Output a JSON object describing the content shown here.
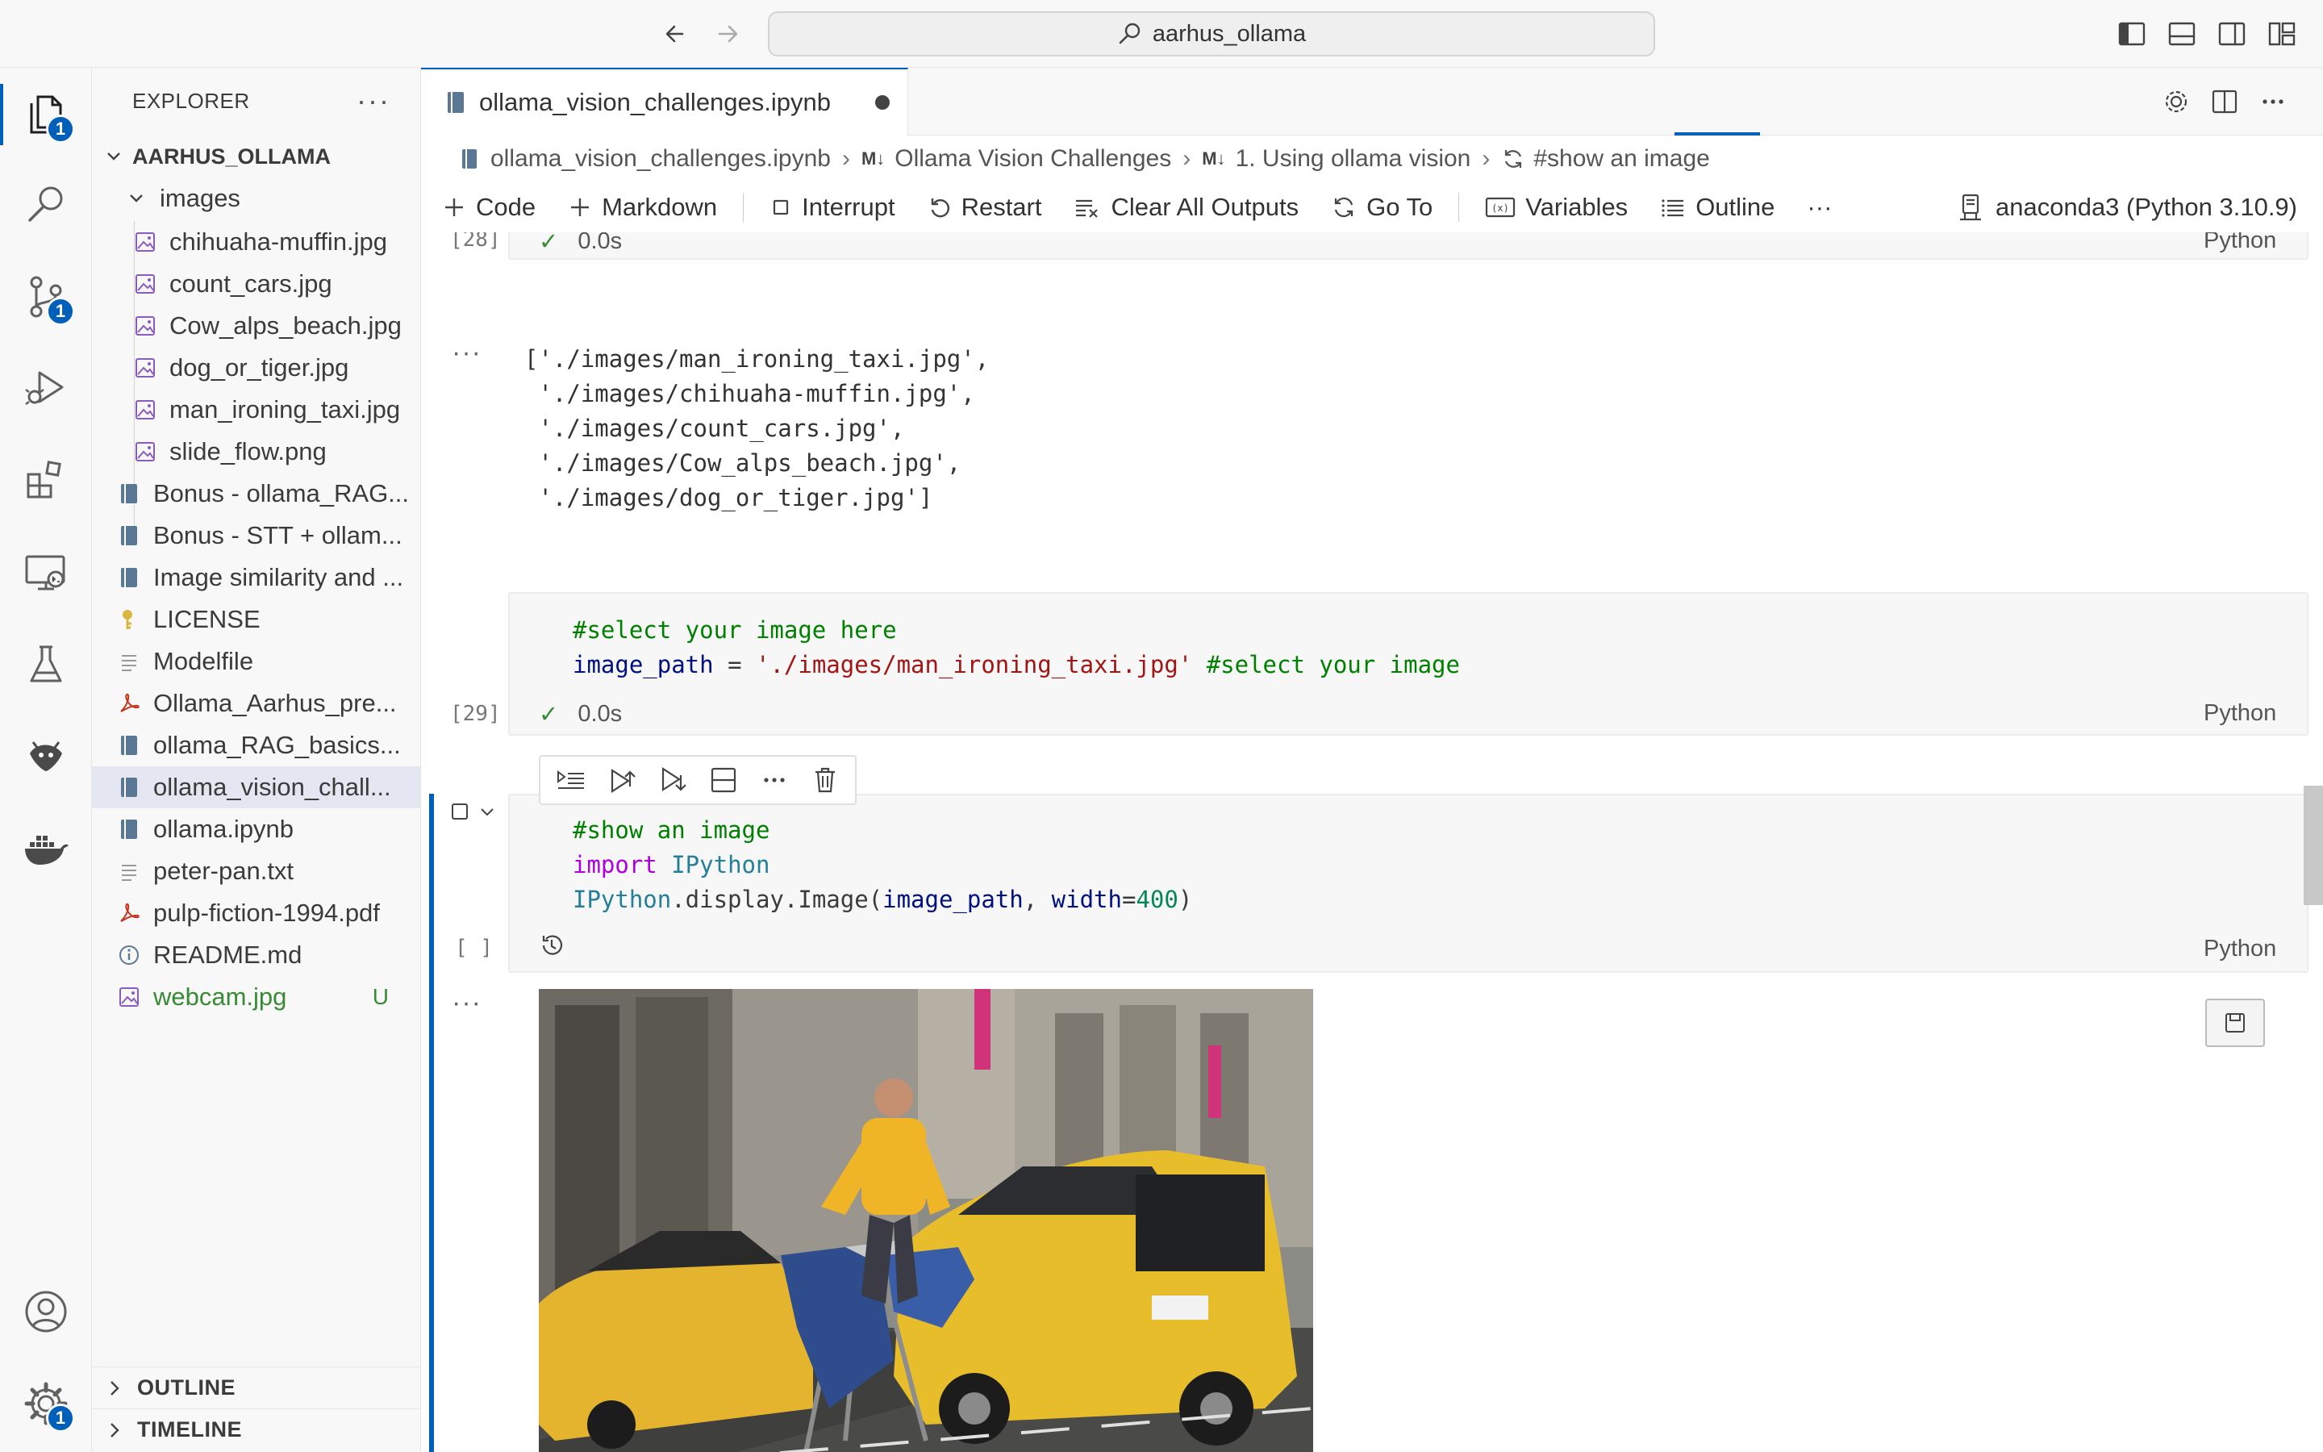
{
  "titlebar": {
    "search_text": "aarhus_ollama",
    "icons": [
      "arrow-left-icon",
      "arrow-right-icon",
      "search-icon",
      "toggle-primary-sidebar-icon",
      "toggle-panel-icon",
      "toggle-secondary-sidebar-icon",
      "customize-layout-icon"
    ]
  },
  "activity_bar": {
    "items": [
      {
        "name": "explorer",
        "icon": "files-icon",
        "badge": "1",
        "active": true
      },
      {
        "name": "search",
        "icon": "search-icon"
      },
      {
        "name": "source-control",
        "icon": "source-control-icon",
        "badge": "1"
      },
      {
        "name": "run-debug",
        "icon": "run-debug-icon"
      },
      {
        "name": "extensions",
        "icon": "extensions-icon"
      },
      {
        "name": "remote-explorer",
        "icon": "remote-explorer-icon"
      },
      {
        "name": "testing",
        "icon": "flask-icon"
      },
      {
        "name": "python-env",
        "icon": "python-env-icon"
      },
      {
        "name": "docker",
        "icon": "docker-icon"
      }
    ],
    "bottom": [
      {
        "name": "accounts",
        "icon": "account-icon"
      },
      {
        "name": "manage",
        "icon": "gear-icon",
        "badge": "1"
      }
    ]
  },
  "sidebar": {
    "title": "EXPLORER",
    "more": "···",
    "root": "AARHUS_OLLAMA",
    "folder": "images",
    "folder_files": [
      "chihuaha-muffin.jpg",
      "count_cars.jpg",
      "Cow_alps_beach.jpg",
      "dog_or_tiger.jpg",
      "man_ironing_taxi.jpg",
      "slide_flow.png"
    ],
    "files": [
      {
        "label": "Bonus - ollama_RAG...",
        "icon": "notebook-icon"
      },
      {
        "label": "Bonus - STT + ollam...",
        "icon": "notebook-icon"
      },
      {
        "label": "Image similarity and ...",
        "icon": "notebook-icon"
      },
      {
        "label": "LICENSE",
        "icon": "key-icon"
      },
      {
        "label": "Modelfile",
        "icon": "lines-file-icon"
      },
      {
        "label": "Ollama_Aarhus_pre...",
        "icon": "pdf-icon"
      },
      {
        "label": "ollama_RAG_basics...",
        "icon": "notebook-icon"
      },
      {
        "label": "ollama_vision_chall...",
        "icon": "notebook-icon",
        "selected": true
      },
      {
        "label": "ollama.ipynb",
        "icon": "notebook-icon"
      },
      {
        "label": "peter-pan.txt",
        "icon": "lines-file-icon"
      },
      {
        "label": "pulp-fiction-1994.pdf",
        "icon": "pdf-icon"
      },
      {
        "label": "README.md",
        "icon": "info-icon"
      },
      {
        "label": "webcam.jpg",
        "icon": "image-file-icon",
        "status": "U"
      }
    ],
    "sections": [
      "OUTLINE",
      "TIMELINE"
    ]
  },
  "editor": {
    "tab": {
      "label": "ollama_vision_challenges.ipynb",
      "dirty": true
    },
    "tab_actions": [
      "settings-icon",
      "split-editor-icon",
      "more-actions-icon"
    ],
    "breadcrumb": [
      {
        "label": "ollama_vision_challenges.ipynb",
        "icon": "notebook-icon"
      },
      {
        "label": "Ollama Vision Challenges",
        "md": "M↓"
      },
      {
        "label": "1. Using ollama vision",
        "md": "M↓"
      },
      {
        "label": "#show an image",
        "icon": "refresh-icon"
      }
    ],
    "toolbar": {
      "code": "Code",
      "markdown": "Markdown",
      "interrupt": "Interrupt",
      "restart": "Restart",
      "clear_all": "Clear All Outputs",
      "goto": "Go To",
      "variables": "Variables",
      "outline": "Outline",
      "more": "···",
      "kernel": "anaconda3 (Python 3.10.9)"
    }
  },
  "notebook": {
    "cell28": {
      "count": "[28]",
      "check": "✓",
      "time": "0.0s",
      "lang": "Python"
    },
    "output28": {
      "dots": "···",
      "lines": [
        "['./images/man_ironing_taxi.jpg',",
        " './images/chihuaha-muffin.jpg',",
        " './images/count_cars.jpg',",
        " './images/Cow_alps_beach.jpg',",
        " './images/dog_or_tiger.jpg']"
      ]
    },
    "cell29": {
      "count": "[29]",
      "line1_comment": "#select your image here",
      "line2_var": "image_path",
      "line2_eq": " = ",
      "line2_str": "'./images/man_ironing_taxi.jpg'",
      "line2_comment": " #select your image",
      "check": "✓",
      "time": "0.0s",
      "lang": "Python"
    },
    "cell_toolbar": [
      "run-by-line-icon",
      "execute-above-icon",
      "execute-below-icon",
      "split-cell-icon",
      "more-icon",
      "delete-icon"
    ],
    "cell30": {
      "count": "[ ]",
      "line1_comment": "#show an image",
      "line2_kw": "import",
      "line2_mod": " IPython",
      "line3_cls": "IPython",
      "line3_rest": ".display.Image(",
      "line3_arg": "image_path",
      "line3_comma": ", ",
      "line3_kwarg": "width",
      "line3_eq": "=",
      "line3_num": "400",
      "line3_close": ")",
      "lang": "Python"
    },
    "output30": {
      "dots": "···",
      "image": "man-ironing-on-taxi-photo"
    }
  }
}
